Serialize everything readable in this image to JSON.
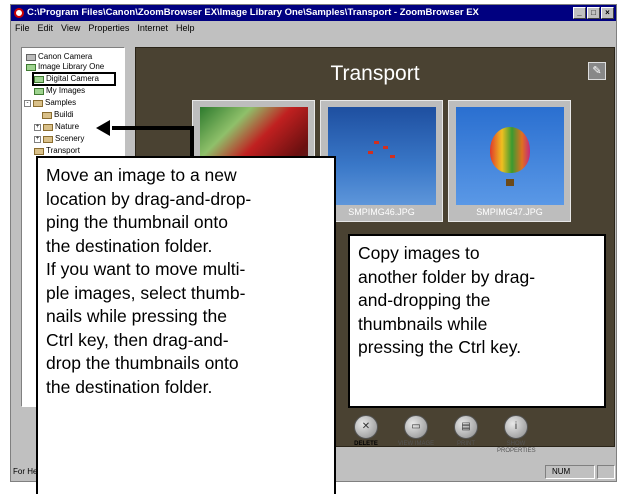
{
  "window": {
    "title": "C:\\Program Files\\Canon\\ZoomBrowser EX\\Image Library One\\Samples\\Transport - ZoomBrowser EX",
    "controls": [
      "_",
      "□",
      "×"
    ]
  },
  "menubar": {
    "items": [
      "File",
      "Edit",
      "View",
      "Properties",
      "Internet",
      "Help"
    ]
  },
  "tree": {
    "items": [
      {
        "label": "Canon Camera",
        "icon": "camera-icon",
        "expander": ""
      },
      {
        "label": "Image Library One",
        "icon": "library-icon",
        "expander": "-"
      },
      {
        "label": "Digital Camera",
        "icon": "folder-icon",
        "expander": ""
      },
      {
        "label": "My Images",
        "icon": "folder-icon",
        "expander": ""
      },
      {
        "label": "Samples",
        "icon": "folder-icon",
        "expander": "-"
      },
      {
        "label": "Buildi",
        "icon": "folder-icon",
        "expander": ""
      },
      {
        "label": "Nature",
        "icon": "folder-icon",
        "expander": "+"
      },
      {
        "label": "Scenery",
        "icon": "folder-icon",
        "expander": "+"
      },
      {
        "label": "Transport",
        "icon": "folder-icon",
        "expander": ""
      }
    ]
  },
  "main": {
    "folder_title": "Transport",
    "thumbnails": [
      {
        "caption": ""
      },
      {
        "caption": "SMPIMG46.JPG"
      },
      {
        "caption": "SMPIMG47.JPG"
      }
    ]
  },
  "toolbar": {
    "buttons": [
      {
        "label": "DELETE",
        "icon": "delete-icon"
      },
      {
        "label": "VIEW IMAGE",
        "icon": "view-image-icon"
      },
      {
        "label": "PRINT",
        "icon": "print-icon"
      },
      {
        "label": "SHOW PROPERTIES",
        "icon": "properties-icon"
      }
    ]
  },
  "statusbar": {
    "left_text": "For He",
    "num_indicator": "NUM"
  },
  "callouts": {
    "left": [
      "Move an image to a new",
      "location by drag-and-drop-",
      "ping the thumbnail onto",
      "the destination folder.",
      "If you want to move multi-",
      "ple images, select thumb-",
      "nails while pressing the",
      "Ctrl key, then drag-and-",
      "drop the thumbnails onto",
      "the destination folder."
    ],
    "right": [
      "Copy images to",
      "another folder by drag-",
      "and-dropping the",
      "thumbnails while",
      "pressing the Ctrl key."
    ]
  }
}
